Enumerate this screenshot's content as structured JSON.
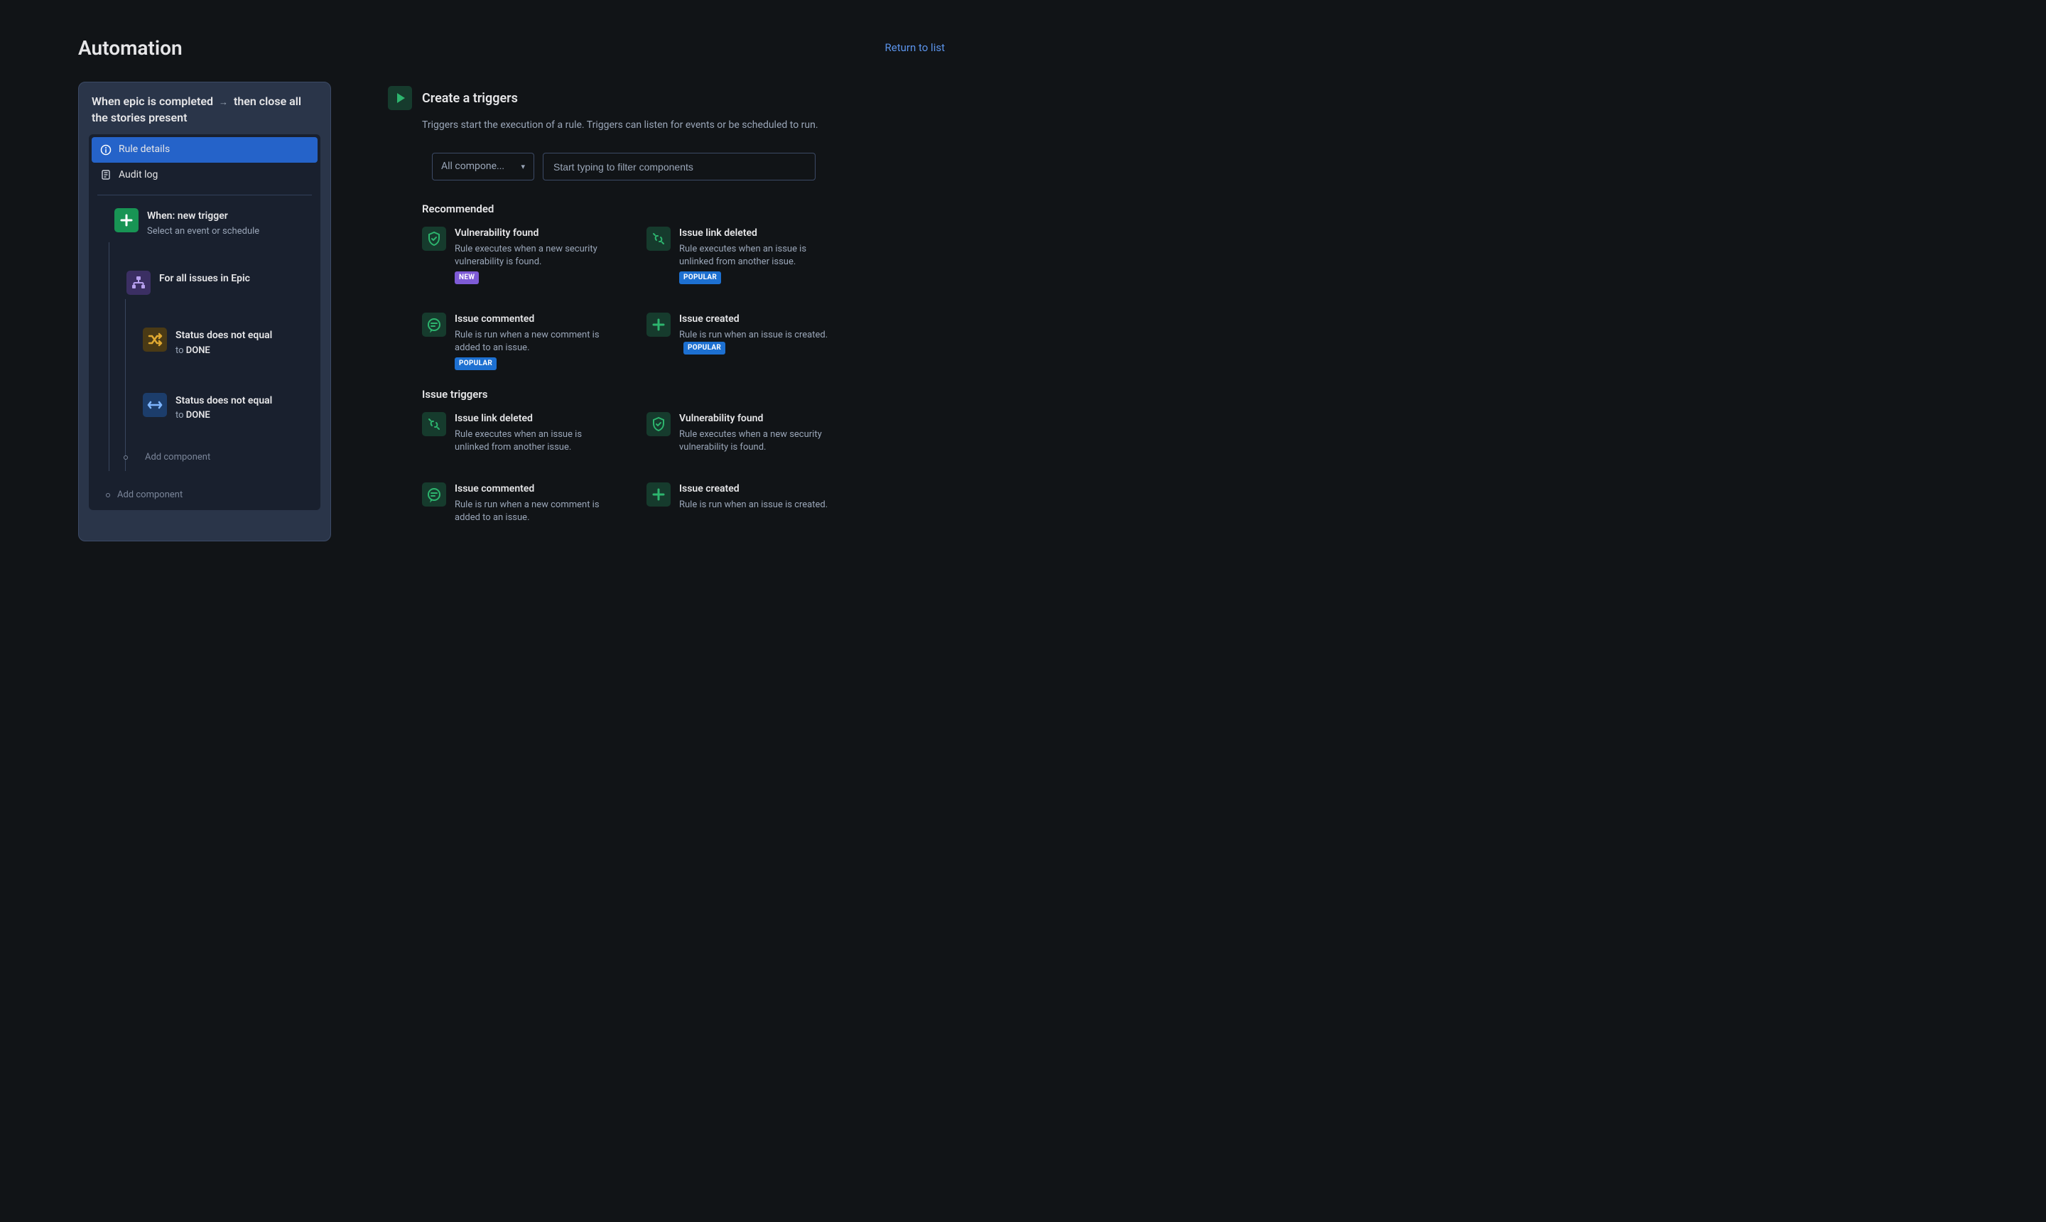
{
  "header": {
    "title": "Automation",
    "return_link": "Return to list"
  },
  "rule": {
    "name_prefix": "When epic is completed",
    "name_suffix": "then close all the stories present",
    "menu": {
      "details": "Rule details",
      "audit": "Audit log"
    },
    "when": {
      "title": "When: new trigger",
      "sub": "Select an event or schedule"
    },
    "branch": {
      "title": "For all issues in Epic"
    },
    "cond1": {
      "title": "Status does not equal",
      "to": "to ",
      "val": "DONE"
    },
    "cond2": {
      "title": "Status does not equal",
      "to": "to ",
      "val": "DONE"
    },
    "add_inner": "Add component",
    "add_outer": "Add component"
  },
  "content": {
    "title": "Create a triggers",
    "desc": "Triggers start the execution of a rule. Triggers can listen for events or be scheduled to run.",
    "select_label": "All compone...",
    "search_placeholder": "Start typing to filter components"
  },
  "sections": [
    {
      "title": "Recommended",
      "items": [
        {
          "icon": "shield",
          "title": "Vulnerability found",
          "desc": "Rule executes when a new security vulnerability is found.",
          "badge": "NEW",
          "badge_type": "new"
        },
        {
          "icon": "unlink",
          "title": "Issue link deleted",
          "desc": "Rule executes when an issue is unlinked from another issue.",
          "badge": "POPULAR",
          "badge_type": "popular"
        },
        {
          "icon": "comment",
          "title": "Issue commented",
          "desc": "Rule is run when a new comment is added to an issue.",
          "badge": "POPULAR",
          "badge_type": "popular"
        },
        {
          "icon": "plus",
          "title": "Issue created",
          "desc": "Rule is run when an issue is created.",
          "badge": "POPULAR",
          "badge_type": "popular",
          "badge_inline": true
        }
      ]
    },
    {
      "title": "Issue triggers",
      "items": [
        {
          "icon": "unlink",
          "title": "Issue link deleted",
          "desc": "Rule executes when an issue is unlinked from another issue."
        },
        {
          "icon": "shield",
          "title": "Vulnerability found",
          "desc": "Rule executes when a new security vulnerability is found."
        },
        {
          "icon": "comment",
          "title": "Issue commented",
          "desc": "Rule is run when a new comment is added to an issue."
        },
        {
          "icon": "plus",
          "title": "Issue created",
          "desc": "Rule is run when an issue is created."
        }
      ]
    }
  ]
}
